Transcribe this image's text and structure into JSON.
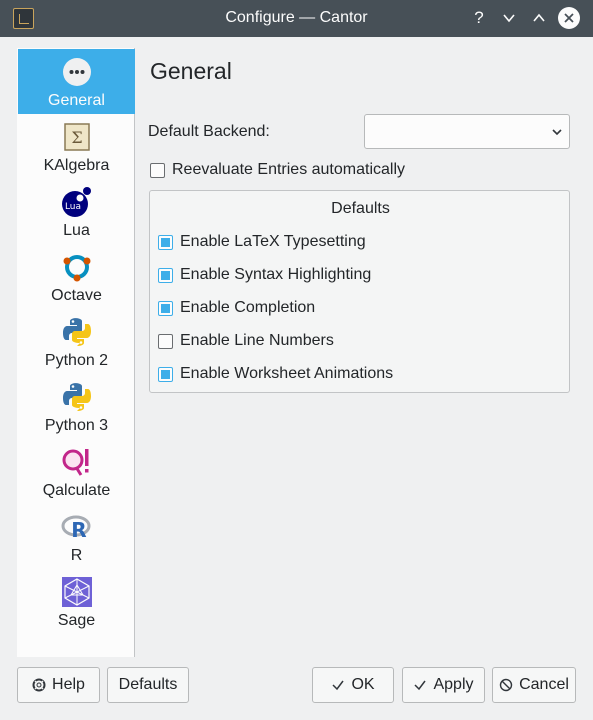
{
  "window": {
    "title": "Configure — Cantor",
    "help_glyph": "?"
  },
  "sidebar": {
    "items": [
      {
        "label": "General",
        "icon": "settings-dots-icon",
        "active": true
      },
      {
        "label": "KAlgebra",
        "icon": "kalgebra-icon"
      },
      {
        "label": "Lua",
        "icon": "lua-icon"
      },
      {
        "label": "Octave",
        "icon": "octave-icon"
      },
      {
        "label": "Python 2",
        "icon": "python-icon"
      },
      {
        "label": "Python 3",
        "icon": "python-icon"
      },
      {
        "label": "Qalculate",
        "icon": "qalculate-icon"
      },
      {
        "label": "R",
        "icon": "r-icon"
      },
      {
        "label": "Sage",
        "icon": "sage-icon"
      }
    ]
  },
  "main": {
    "title": "General",
    "backend_label": "Default Backend:",
    "backend_value": "",
    "reevaluate": {
      "label": "Reevaluate Entries automatically",
      "checked": false
    },
    "defaults_group": {
      "title": "Defaults",
      "options": [
        {
          "label": "Enable LaTeX Typesetting",
          "checked": true
        },
        {
          "label": "Enable Syntax Highlighting",
          "checked": true
        },
        {
          "label": "Enable Completion",
          "checked": true
        },
        {
          "label": "Enable Line Numbers",
          "checked": false
        },
        {
          "label": "Enable Worksheet Animations",
          "checked": true
        }
      ]
    }
  },
  "buttons": {
    "help": "Help",
    "defaults": "Defaults",
    "ok": "OK",
    "apply": "Apply",
    "cancel": "Cancel"
  },
  "colors": {
    "accent": "#3daee9",
    "titlebar": "#475057",
    "window_bg": "#eff0f1"
  }
}
